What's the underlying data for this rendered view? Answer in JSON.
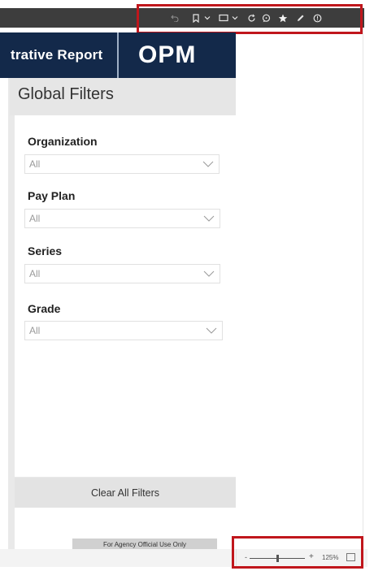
{
  "toolbar": {
    "icons": [
      "undo-icon",
      "bookmark-icon",
      "chevron-down-icon",
      "view-icon",
      "chevron-down-icon",
      "refresh-icon",
      "comment-icon",
      "star-icon",
      "edit-icon",
      "info-icon"
    ]
  },
  "header": {
    "title": "trative Report",
    "logo_text": "OPM"
  },
  "filters": {
    "title": "Global Filters",
    "organization": {
      "label": "Organization",
      "value": "All"
    },
    "pay_plan": {
      "label": "Pay Plan",
      "value": "All"
    },
    "series": {
      "label": "Series",
      "value": "All"
    },
    "grade": {
      "label": "Grade",
      "value": "All"
    },
    "clear_label": "Clear All Filters"
  },
  "footer": {
    "notice": "For Agency Official Use Only"
  },
  "status": {
    "zoom_minus": "-",
    "zoom_plus": "+",
    "zoom_level": "125%",
    "zoom_fraction": 0.5
  },
  "colors": {
    "header_bg": "#13294a",
    "highlight_red": "#c0161c",
    "toolbar_bg": "#3d3d3d"
  }
}
